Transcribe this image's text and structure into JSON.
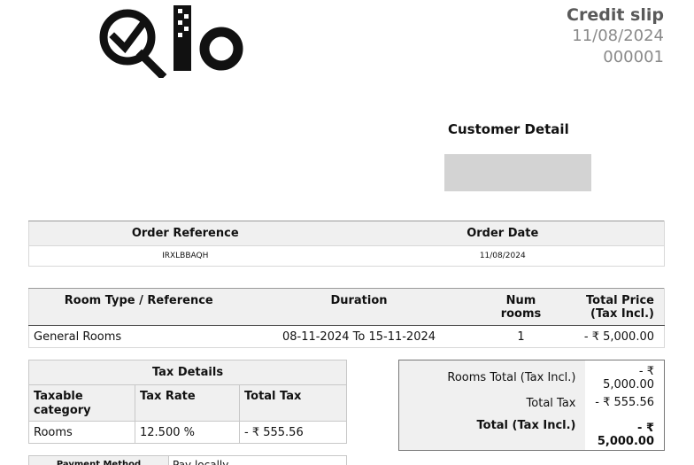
{
  "logo": {
    "text": "Qlo"
  },
  "header": {
    "title": "Credit slip",
    "date": "11/08/2024",
    "number": "000001"
  },
  "customer": {
    "title": "Customer Detail"
  },
  "order": {
    "headers": [
      "Order Reference",
      "Order Date"
    ],
    "reference": "IRXLBBAQH",
    "date": "11/08/2024"
  },
  "rooms": {
    "headers": {
      "type": "Room Type / Reference",
      "duration": "Duration",
      "num_line1": "Num",
      "num_line2": "rooms",
      "price_line1": "Total Price",
      "price_line2": "(Tax Incl.)"
    },
    "rows": [
      {
        "type": "General Rooms",
        "duration": "08-11-2024 To 15-11-2024",
        "num": "1",
        "price": "- ₹ 5,000.00"
      }
    ]
  },
  "tax": {
    "title": "Tax Details",
    "columns": [
      "Taxable category",
      "Tax Rate",
      "Total Tax"
    ],
    "rows": [
      {
        "category": "Rooms",
        "rate": "12.500 %",
        "total": "- ₹ 555.56"
      }
    ]
  },
  "totals": {
    "rooms_total_label": "Rooms Total (Tax Incl.)",
    "rooms_total_value": "- ₹ 5,000.00",
    "total_tax_label": "Total Tax",
    "total_tax_value": "- ₹ 555.56",
    "grand_total_label": "Total (Tax Incl.)",
    "grand_total_value_line1": "- ₹",
    "grand_total_value_line2": "5,000.00"
  },
  "payment": {
    "method_label": "Payment Method",
    "method_value": "Pay locally"
  }
}
